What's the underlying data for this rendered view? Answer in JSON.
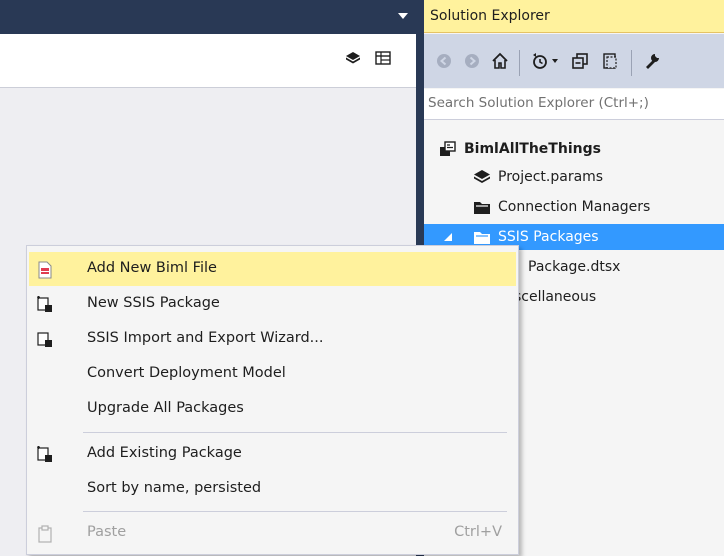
{
  "solution_explorer": {
    "title": "Solution Explorer",
    "search_placeholder": "Search Solution Explorer (Ctrl+;)",
    "toolbar_icons": [
      "back-icon",
      "forward-icon",
      "home-icon",
      "pending-changes-icon",
      "collapse-all-icon",
      "show-all-files-icon",
      "properties-icon"
    ],
    "tree": {
      "project": "BimlAllTheThings",
      "project_params": "Project.params",
      "connection_managers": "Connection Managers",
      "ssis_packages": "SSIS Packages",
      "package": "Package.dtsx",
      "miscellaneous": "Miscellaneous"
    }
  },
  "context_menu": {
    "items": [
      {
        "label": "Add New Biml File",
        "icon": "biml-file-icon",
        "highlighted": true
      },
      {
        "label": "New SSIS Package",
        "icon": "ssis-package-icon"
      },
      {
        "label": "SSIS Import and Export Wizard...",
        "icon": "wizard-icon"
      },
      {
        "label": "Convert Deployment Model"
      },
      {
        "label": "Upgrade All Packages"
      },
      {
        "label": "Add Existing Package",
        "icon": "existing-package-icon"
      },
      {
        "label": "Sort by name, persisted"
      },
      {
        "label": "Paste",
        "shortcut": "Ctrl+V",
        "icon": "paste-icon",
        "disabled": true
      }
    ]
  },
  "colors": {
    "title_bar": "#293955",
    "highlight": "#fff29d",
    "selection": "#3399ff",
    "toolbar": "#cfd6e5"
  }
}
